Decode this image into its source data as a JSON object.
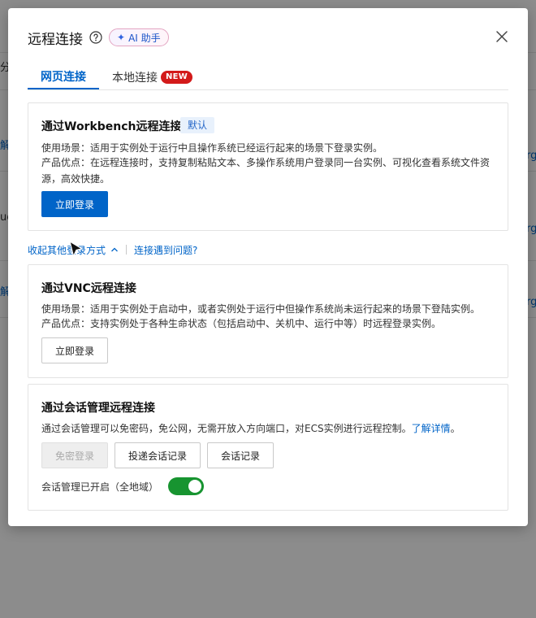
{
  "background": {
    "fragments": [
      "分",
      "解",
      "ue",
      "解",
      "rg",
      "rg",
      "rg"
    ]
  },
  "modal": {
    "title": "远程连接",
    "ai_badge": "AI 助手",
    "tabs": [
      {
        "label": "网页连接",
        "active": true
      },
      {
        "label": "本地连接",
        "badge": "NEW"
      }
    ],
    "workbench": {
      "title": "通过Workbench远程连接",
      "tag": "默认",
      "scene": "使用场景：适用于实例处于运行中且操作系统已经运行起来的场景下登录实例。",
      "advantage_line1": "产品优点：在远程连接时，支持复制粘贴文本、多操作系统用户登录同一台实例、可视化查看系统文件资",
      "advantage_line2": "源，高效快捷。",
      "button": "立即登录"
    },
    "collapse_link": "收起其他登录方式",
    "problem_link": "连接遇到问题?",
    "vnc": {
      "title": "通过VNC远程连接",
      "scene": "使用场景：适用于实例处于启动中，或者实例处于运行中但操作系统尚未运行起来的场景下登陆实例。",
      "advantage": "产品优点：支持实例处于各种生命状态（包括启动中、关机中、运行中等）时远程登录实例。",
      "button": "立即登录"
    },
    "session": {
      "title": "通过会话管理远程连接",
      "desc": "通过会话管理可以免密码，免公网，无需开放入方向端口，对ECS实例进行远程控制。",
      "learn_more": "了解详情",
      "desc_end": "。",
      "btn_passwordless": "免密登录",
      "btn_deliver": "投递会话记录",
      "btn_records": "会话记录",
      "status_label": "会话管理已开启（全地域）",
      "toggle_on": true
    }
  },
  "colors": {
    "primary": "#0064c8",
    "new_badge": "#d31a1a",
    "toggle_on": "#179430"
  }
}
